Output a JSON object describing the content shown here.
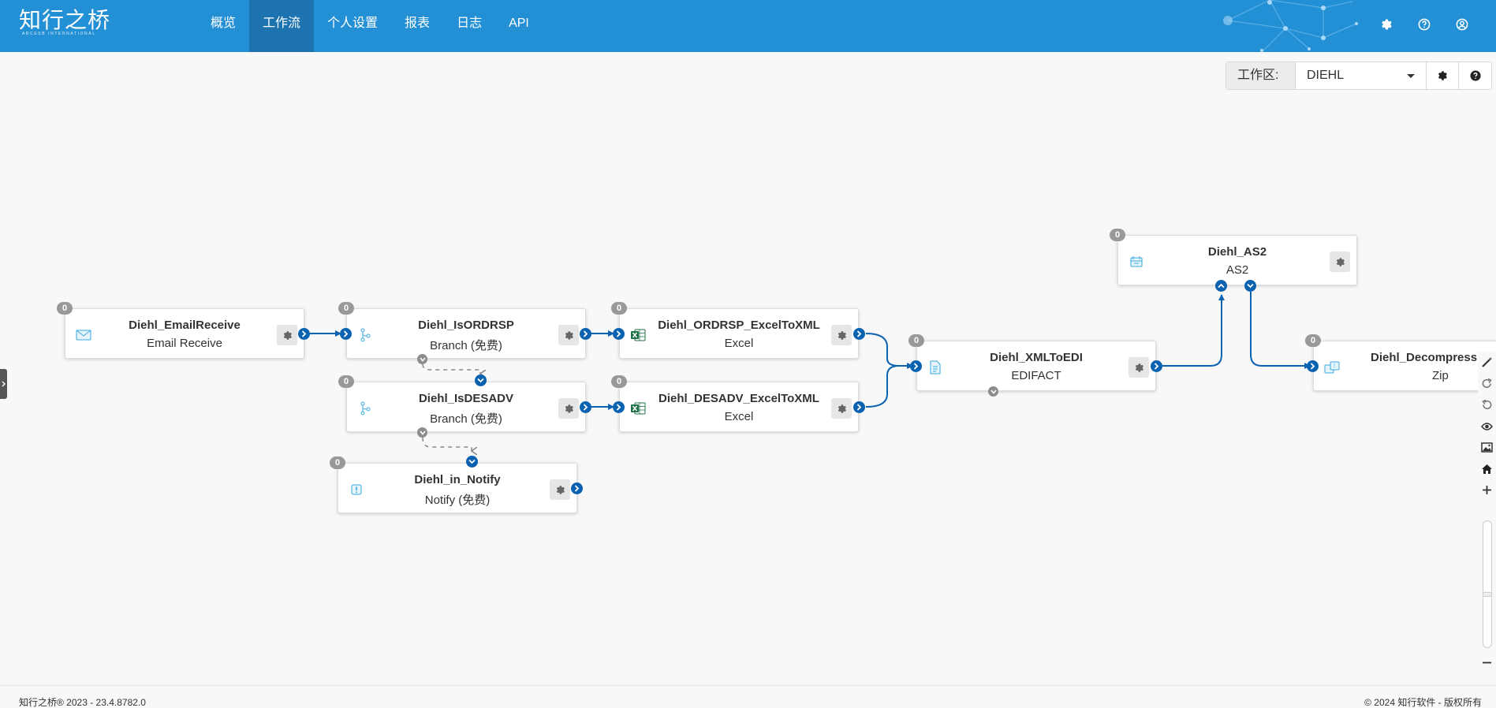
{
  "header": {
    "logo_text": "知行之桥",
    "logo_sub": "ARCESB INTERNATIONAL",
    "nav": [
      "概览",
      "工作流",
      "个人设置",
      "报表",
      "日志",
      "API"
    ],
    "active_nav": "工作流",
    "icons": [
      "gear-icon",
      "help-icon",
      "user-icon"
    ],
    "bg_color": "#2390d6",
    "active_color": "#1d73b0"
  },
  "workspace": {
    "label": "工作区:",
    "value": "DIEHL"
  },
  "nodes": {
    "email_receive": {
      "title": "Diehl_EmailReceive",
      "subtitle": "Email Receive",
      "count": "0"
    },
    "is_ordrsp": {
      "title": "Diehl_IsORDRSP",
      "subtitle": "Branch (免费)",
      "count": "0"
    },
    "is_desadv": {
      "title": "Diehl_IsDESADV",
      "subtitle": "Branch (免费)",
      "count": "0"
    },
    "in_notify": {
      "title": "Diehl_in_Notify",
      "subtitle": "Notify (免费)",
      "count": "0"
    },
    "ordrsp_excel": {
      "title": "Diehl_ORDRSP_ExcelToXML",
      "subtitle": "Excel",
      "count": "0"
    },
    "desadv_excel": {
      "title": "Diehl_DESADV_ExcelToXML",
      "subtitle": "Excel",
      "count": "0"
    },
    "xml_to_edi": {
      "title": "Diehl_XMLToEDI",
      "subtitle": "EDIFACT",
      "count": "0"
    },
    "as2": {
      "title": "Diehl_AS2",
      "subtitle": "AS2",
      "count": "0"
    },
    "decompression": {
      "title": "Diehl_Decompression",
      "subtitle": "Zip",
      "count": "0"
    }
  },
  "right_toolbar": [
    "magic-wand-icon",
    "redo-icon",
    "undo-icon",
    "eye-icon",
    "image-icon",
    "home-icon",
    "zoom-in-icon",
    "zoom-out-icon"
  ],
  "footer": {
    "left": "知行之桥® 2023 - 23.4.8782.0",
    "right": "© 2024 知行软件 - 版权所有"
  },
  "colors": {
    "port": "#0b62b0",
    "link": "#0b62b0"
  }
}
